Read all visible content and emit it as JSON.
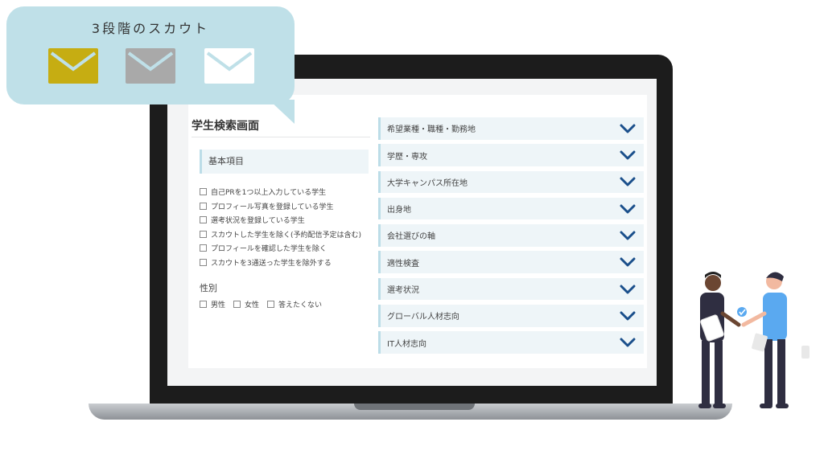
{
  "bubble": {
    "title": "3段階のスカウト",
    "envelopes": [
      {
        "icon": "envelope-icon",
        "color": "#c6ad12"
      },
      {
        "icon": "envelope-icon",
        "color": "#a9a9a9"
      },
      {
        "icon": "envelope-icon",
        "color": "#ffffff"
      }
    ]
  },
  "page": {
    "title": "学生検索画面",
    "section_basic": "基本項目",
    "checkboxes": [
      "自己PRを1つ以上入力している学生",
      "プロフィール写真を登録している学生",
      "選考状況を登録している学生",
      "スカウトした学生を除く(予約配信予定は含む)",
      "プロフィールを確認した学生を除く",
      "スカウトを3通送った学生を除外する"
    ],
    "gender_label": "性別",
    "gender_options": [
      "男性",
      "女性",
      "答えたくない"
    ],
    "filters": [
      "希望業種・職種・勤務地",
      "学歴・専攻",
      "大学キャンパス所在地",
      "出身地",
      "会社選びの軸",
      "適性検査",
      "選考状況",
      "グローバル人材志向",
      "IT人材志向"
    ]
  },
  "colors": {
    "accent_chevron": "#1a4f8b",
    "row_bg": "#eef5f8",
    "bubble_bg": "#bfe0e8",
    "person_shirt": "#5aa9f0"
  }
}
